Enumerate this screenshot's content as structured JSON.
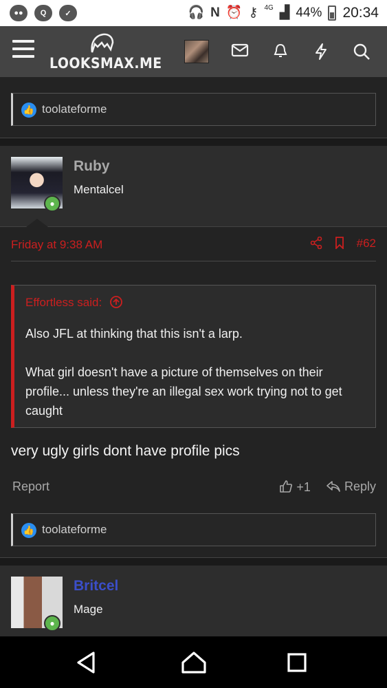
{
  "statusbar": {
    "left_icons": [
      "wechat-icon",
      "qq-icon",
      "messenger-icon"
    ],
    "network": "4G",
    "battery": "44%",
    "time": "20:34"
  },
  "nav": {
    "logo_text": "LOOKSMAX.ME",
    "icons": [
      "menu-icon",
      "user-avatar",
      "mail-icon",
      "bell-icon",
      "bolt-icon",
      "search-icon"
    ]
  },
  "top_reaction": {
    "user": "toolateforme"
  },
  "post1": {
    "username": "Ruby",
    "user_title": "Mentalcel",
    "username_color": "#a9a9a9",
    "date": "Friday at 9:38 AM",
    "number": "#62",
    "quote_author": "Effortless said:",
    "quote_lines": [
      "Also JFL at thinking that this isn't a larp.",
      "What girl doesn't have a picture of themselves on their profile... unless they're an illegal sex work trying not to get caught"
    ],
    "text": "very ugly girls dont have profile pics",
    "report": "Report",
    "like_count": "+1",
    "reply": "Reply",
    "reaction_user": "toolateforme"
  },
  "post2": {
    "username": "Britcel",
    "user_title": "Mage",
    "username_color": "#3b4ec9"
  },
  "colors": {
    "accent": "#cc1f1f",
    "like_blue": "#2a8ef0",
    "online_green": "#5db54d"
  }
}
